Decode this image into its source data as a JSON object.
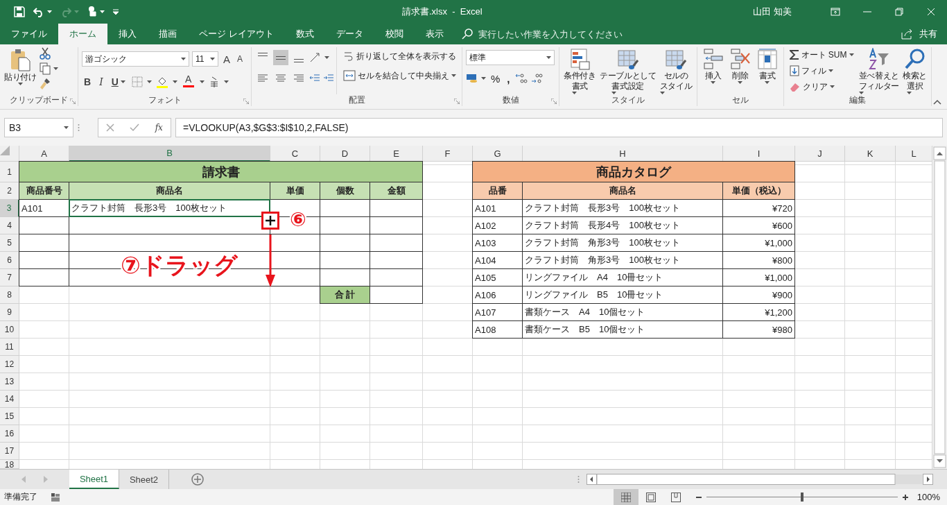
{
  "window": {
    "title": "請求書.xlsx  -  Excel",
    "user": "山田 知美"
  },
  "tabs": [
    {
      "label": "ファイル",
      "selected": false
    },
    {
      "label": "ホーム",
      "selected": true
    },
    {
      "label": "挿入",
      "selected": false
    },
    {
      "label": "描画",
      "selected": false
    },
    {
      "label": "ページ レイアウト",
      "selected": false
    },
    {
      "label": "数式",
      "selected": false
    },
    {
      "label": "データ",
      "selected": false
    },
    {
      "label": "校閲",
      "selected": false
    },
    {
      "label": "表示",
      "selected": false
    }
  ],
  "tell_me": {
    "placeholder": "実行したい作業を入力してください"
  },
  "share": "共有",
  "ribbon": {
    "clipboard": {
      "label": "クリップボード",
      "paste": "貼り付け"
    },
    "font": {
      "label": "フォント",
      "family": "游ゴシック",
      "size": "11",
      "grow": "A",
      "shrink": "A",
      "bold": "B",
      "italic": "I",
      "underline": "U",
      "font_color": "A"
    },
    "alignment": {
      "label": "配置",
      "vertical": [
        {
          "selected": false
        },
        {
          "selected": true
        },
        {
          "selected": false
        }
      ],
      "wrap_text": "折り返して全体を表示する",
      "merge_center": "セルを結合して中央揃え"
    },
    "number": {
      "label": "数値",
      "format": "標準",
      "percent": "%",
      "comma": ","
    },
    "styles": {
      "label": "スタイル",
      "buttons": [
        {
          "lines": [
            "条件付き",
            "書式"
          ]
        },
        {
          "lines": [
            "テーブルとして",
            "書式設定"
          ]
        },
        {
          "lines": [
            "セルの",
            "スタイル"
          ]
        }
      ]
    },
    "cells": {
      "label": "セル",
      "buttons": [
        {
          "label": "挿入"
        },
        {
          "label": "削除"
        },
        {
          "label": "書式"
        }
      ]
    },
    "editing": {
      "label": "編集",
      "autosum": "オート SUM",
      "fill": "フィル",
      "clear": "クリア",
      "sort": [
        "並べ替えと",
        "フィルター"
      ],
      "find": [
        "検索と",
        "選択"
      ]
    }
  },
  "formula_bar": {
    "name_box": "B3",
    "fx": "fx",
    "formula": "=VLOOKUP(A3,$G$3:$I$10,2,FALSE)"
  },
  "sheet": {
    "columns": [
      {
        "label": "A",
        "selected": false
      },
      {
        "label": "B",
        "selected": true
      },
      {
        "label": "C",
        "selected": false
      },
      {
        "label": "D",
        "selected": false
      },
      {
        "label": "E",
        "selected": false
      },
      {
        "label": "F",
        "selected": false
      },
      {
        "label": "G",
        "selected": false
      },
      {
        "label": "H",
        "selected": false
      },
      {
        "label": "I",
        "selected": false
      },
      {
        "label": "J",
        "selected": false
      },
      {
        "label": "K",
        "selected": false
      },
      {
        "label": "L",
        "selected": false
      }
    ],
    "rows": [
      {
        "label": "1",
        "selected": false
      },
      {
        "label": "2",
        "selected": false
      },
      {
        "label": "3",
        "selected": true
      },
      {
        "label": "4",
        "selected": false
      },
      {
        "label": "5",
        "selected": false
      },
      {
        "label": "6",
        "selected": false
      },
      {
        "label": "7",
        "selected": false
      },
      {
        "label": "8",
        "selected": false
      },
      {
        "label": "9",
        "selected": false
      },
      {
        "label": "10",
        "selected": false
      },
      {
        "label": "11",
        "selected": false
      },
      {
        "label": "12",
        "selected": false
      },
      {
        "label": "13",
        "selected": false
      },
      {
        "label": "14",
        "selected": false
      },
      {
        "label": "15",
        "selected": false
      },
      {
        "label": "16",
        "selected": false
      },
      {
        "label": "17",
        "selected": false
      },
      {
        "label": "18",
        "selected": false
      }
    ],
    "invoice": {
      "title": "請求書",
      "headers": [
        "商品番号",
        "商品名",
        "単価",
        "個数",
        "金額"
      ],
      "rows": [
        {
          "product_no": "A101",
          "product_name": "クラフト封筒　長形3号　100枚セット"
        }
      ],
      "total_label": "合 計"
    },
    "catalog": {
      "title": "商品カタログ",
      "headers": [
        "品番",
        "商品名",
        "単価（税込）"
      ],
      "rows": [
        {
          "code": "A101",
          "name": "クラフト封筒　長形3号　100枚セット",
          "price": "¥720"
        },
        {
          "code": "A102",
          "name": "クラフト封筒　長形4号　100枚セット",
          "price": "¥600"
        },
        {
          "code": "A103",
          "name": "クラフト封筒　角形3号　100枚セット",
          "price": "¥1,000"
        },
        {
          "code": "A104",
          "name": "クラフト封筒　角形3号　100枚セット",
          "price": "¥800"
        },
        {
          "code": "A105",
          "name": "リングファイル　A4　10冊セット",
          "price": "¥1,000"
        },
        {
          "code": "A106",
          "name": "リングファイル　B5　10冊セット",
          "price": "¥900"
        },
        {
          "code": "A107",
          "name": "書類ケース　A4　10個セット",
          "price": "¥1,200"
        },
        {
          "code": "A108",
          "name": "書類ケース　B5　10個セット",
          "price": "¥980"
        }
      ]
    },
    "annotations": {
      "step6": "⑥",
      "step7": "⑦ドラッグ"
    }
  },
  "sheet_tabs": [
    {
      "label": "Sheet1",
      "selected": true
    },
    {
      "label": "Sheet2",
      "selected": false
    }
  ],
  "status_bar": {
    "status": "準備完了",
    "zoom": {
      "level": 0.5,
      "reading": "100%"
    }
  }
}
